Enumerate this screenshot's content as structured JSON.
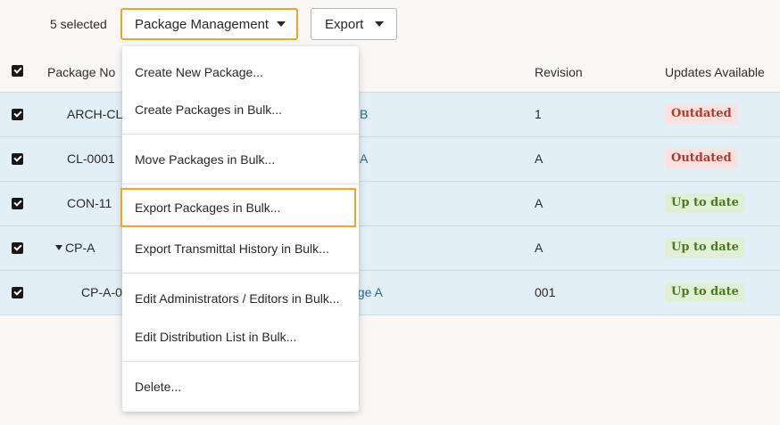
{
  "toolbar": {
    "selected_count": "5 selected",
    "package_management_label": "Package Management",
    "export_label": "Export"
  },
  "table": {
    "columns": [
      "Package No",
      "Revision",
      "Updates Available"
    ],
    "rows": [
      {
        "package_no": "ARCH-CL-",
        "title": "B",
        "revision": "1",
        "status": "Outdated"
      },
      {
        "package_no": "CL-0001",
        "title": "A",
        "revision": "A",
        "status": "Outdated"
      },
      {
        "package_no": "CON-11",
        "title": "",
        "revision": "A",
        "status": "Up to date"
      },
      {
        "package_no": "CP-A",
        "title": "",
        "revision": "A",
        "status": "Up to date"
      },
      {
        "package_no": "CP-A-0",
        "title": "age A",
        "revision": "001",
        "status": "Up to date"
      }
    ]
  },
  "menu": {
    "items": [
      "Create New Package...",
      "Create Packages in Bulk...",
      "Move Packages in Bulk...",
      "Export Packages in Bulk...",
      "Export Transmittal History in Bulk...",
      "Edit Administrators / Editors in Bulk...",
      "Edit Distribution List in Bulk...",
      "Delete..."
    ]
  },
  "colors": {
    "highlight": "#f0a623",
    "row_selected": "#e3eff6",
    "outdated_bg": "#fbe2df",
    "outdated_text": "#b3392d",
    "uptodate_bg": "#e1efd6",
    "uptodate_text": "#4a7a1f",
    "link": "#2a6b94"
  }
}
